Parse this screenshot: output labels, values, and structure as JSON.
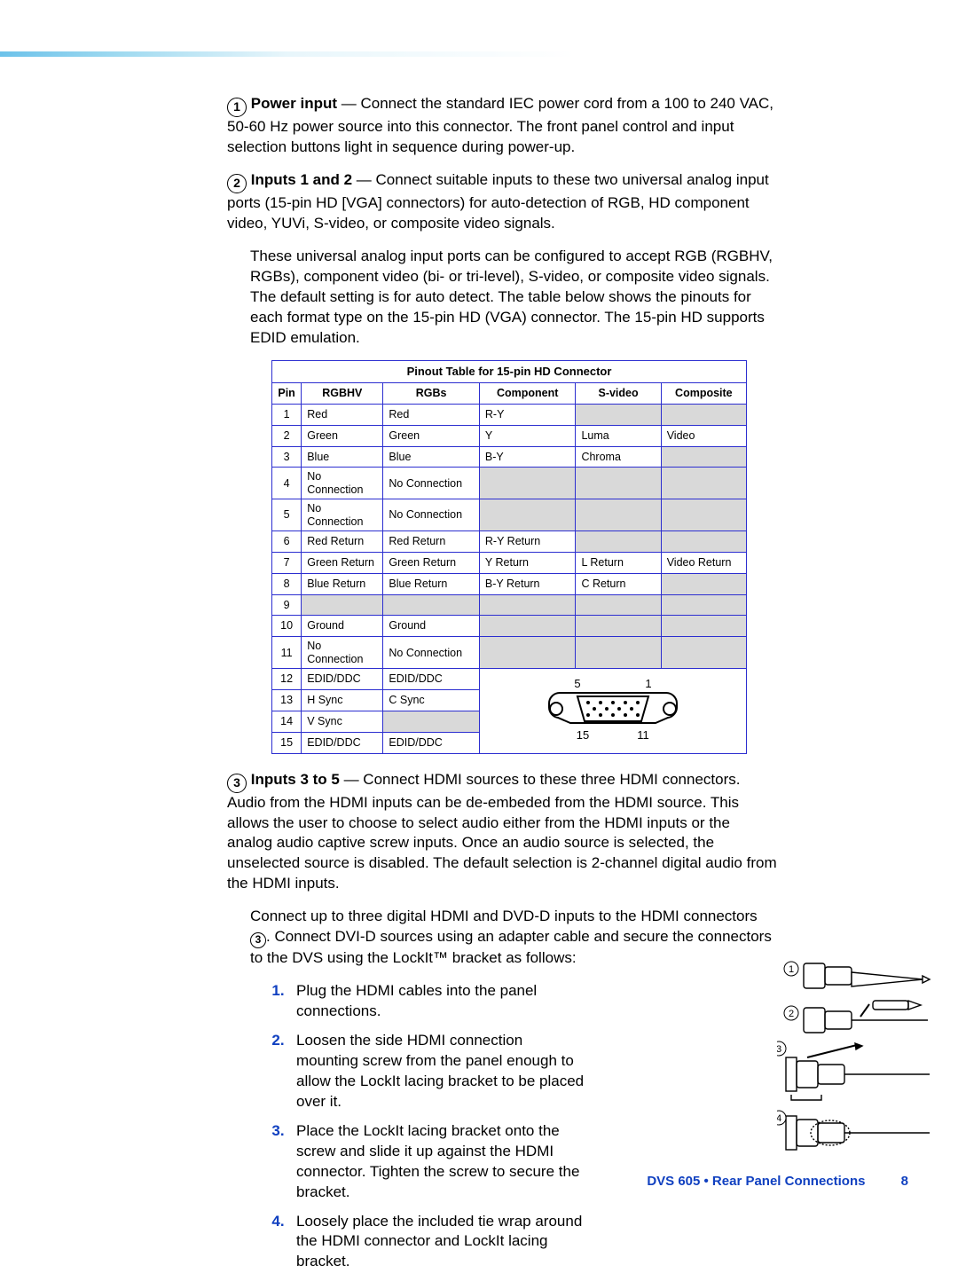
{
  "callouts": {
    "c1": {
      "num": "1",
      "title": "Power input",
      "body": " — Connect the standard IEC power cord from a 100 to 240 VAC, 50-60 Hz power source into this connector. The front panel control and input selection buttons light in sequence during power-up."
    },
    "c2": {
      "num": "2",
      "title": "Inputs 1 and 2",
      "body": " — Connect suitable inputs to these two universal analog input ports (15-pin HD [VGA] connectors) for auto-detection of RGB, HD component video, YUVi, S-video, or composite video signals."
    },
    "c2_extra": "These universal analog input ports can be configured to accept RGB (RGBHV, RGBs), component video (bi- or tri-level), S-video, or composite video signals. The default setting is for auto detect. The table below shows the pinouts for each format type on the 15-pin HD (VGA) connector. The 15-pin HD supports EDID emulation.",
    "c3": {
      "num": "3",
      "title": "Inputs 3 to 5",
      "body": " — Connect HDMI sources to these three HDMI connectors. Audio from the HDMI inputs can be de-embeded from the HDMI source. This allows the user to choose to select audio either from the HDMI inputs or the analog audio captive screw inputs. Once an audio source is selected, the unselected source is disabled. The default selection is 2-channel digital audio from the HDMI inputs."
    },
    "c3_extra_a": "Connect up to three digital HDMI and DVD-D inputs to the HDMI connectors ",
    "c3_extra_b": ". Connect DVI-D sources using an adapter cable and secure the connectors to the DVS using the LockIt™ bracket as follows:"
  },
  "table": {
    "title": "Pinout Table for 15-pin HD Connector",
    "headers": {
      "pin": "Pin",
      "rgbhv": "RGBHV",
      "rgbs": "RGBs",
      "comp": "Component",
      "svid": "S-video",
      "compst": "Composite"
    },
    "rows": [
      {
        "pin": "1",
        "rgbhv": "Red",
        "rgbs": "Red",
        "comp": "R-Y",
        "svid": "",
        "compst": "",
        "svid_grey": true,
        "compst_grey": true
      },
      {
        "pin": "2",
        "rgbhv": "Green",
        "rgbs": "Green",
        "comp": "Y",
        "svid": "Luma",
        "compst": "Video"
      },
      {
        "pin": "3",
        "rgbhv": "Blue",
        "rgbs": "Blue",
        "comp": "B-Y",
        "svid": "Chroma",
        "compst": "",
        "compst_grey": true
      },
      {
        "pin": "4",
        "rgbhv": "No Connection",
        "rgbs": "No Connection",
        "comp": "",
        "svid": "",
        "compst": "",
        "comp_grey": true,
        "svid_grey": true,
        "compst_grey": true,
        "tall": true
      },
      {
        "pin": "5",
        "rgbhv": "No Connection",
        "rgbs": "No Connection",
        "comp": "",
        "svid": "",
        "compst": "",
        "comp_grey": true,
        "svid_grey": true,
        "compst_grey": true,
        "tall": true
      },
      {
        "pin": "6",
        "rgbhv": "Red Return",
        "rgbs": "Red Return",
        "comp": "R-Y Return",
        "svid": "",
        "compst": "",
        "svid_grey": true,
        "compst_grey": true
      },
      {
        "pin": "7",
        "rgbhv": "Green Return",
        "rgbs": "Green Return",
        "comp": "Y Return",
        "svid": "L Return",
        "compst": "Video Return"
      },
      {
        "pin": "8",
        "rgbhv": "Blue Return",
        "rgbs": "Blue Return",
        "comp": "B-Y Return",
        "svid": "C Return",
        "compst": "",
        "compst_grey": true
      },
      {
        "pin": "9",
        "rgbhv": "",
        "rgbs": "",
        "comp": "",
        "svid": "",
        "compst": "",
        "rgbhv_grey": true,
        "rgbs_grey": true,
        "comp_grey": true,
        "svid_grey": true,
        "compst_grey": true
      },
      {
        "pin": "10",
        "rgbhv": "Ground",
        "rgbs": "Ground",
        "comp": "",
        "svid": "",
        "compst": "",
        "comp_grey": true,
        "svid_grey": true,
        "compst_grey": true
      },
      {
        "pin": "11",
        "rgbhv": "No Connection",
        "rgbs": "No Connection",
        "comp": "",
        "svid": "",
        "compst": "",
        "comp_grey": true,
        "svid_grey": true,
        "compst_grey": true,
        "tall": true
      },
      {
        "pin": "12",
        "rgbhv": "EDID/DDC",
        "rgbs": "EDID/DDC",
        "connfirst": true
      },
      {
        "pin": "13",
        "rgbhv": "H Sync",
        "rgbs": "C Sync"
      },
      {
        "pin": "14",
        "rgbhv": "V Sync",
        "rgbs": "",
        "rgbs_grey": true
      },
      {
        "pin": "15",
        "rgbhv": "EDID/DDC",
        "rgbs": "EDID/DDC"
      }
    ],
    "connector_labels": {
      "tl": "5",
      "tr": "1",
      "bl": "15",
      "br": "11"
    }
  },
  "steps": [
    "Plug the HDMI cables into the panel connections.",
    "Loosen the side HDMI connection mounting screw from the panel enough to allow the LockIt lacing bracket to be placed over it.",
    "Place the LockIt lacing bracket onto the screw and slide it up against the HDMI connector. Tighten the screw to secure the bracket.",
    "Loosely place the included tie wrap around the HDMI connector and LockIt lacing bracket."
  ],
  "diagram_labels": [
    "1",
    "2",
    "3",
    "4"
  ],
  "footer": {
    "section": "DVS 605 • Rear Panel Connections",
    "page": "8"
  }
}
